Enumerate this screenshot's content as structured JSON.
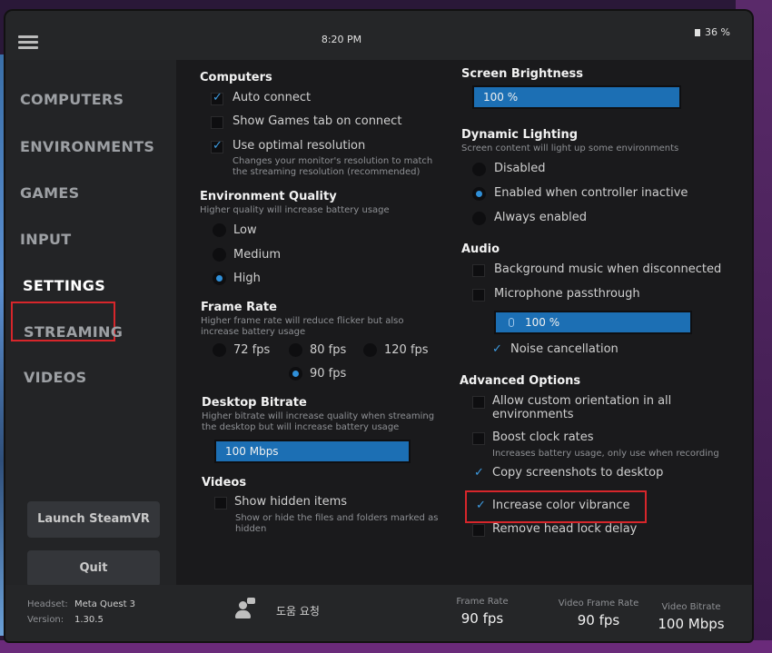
{
  "topbar": {
    "time": "8:20 PM",
    "battery": "36 %"
  },
  "sidebar": {
    "items": [
      "COMPUTERS",
      "ENVIRONMENTS",
      "GAMES",
      "INPUT",
      "SETTINGS",
      "STREAMING",
      "VIDEOS"
    ],
    "active": "SETTINGS",
    "launch_label": "Launch SteamVR",
    "quit_label": "Quit"
  },
  "computers": {
    "title": "Computers",
    "auto_connect": "Auto connect",
    "show_games_tab": "Show Games tab on connect",
    "optimal_resolution": "Use optimal resolution",
    "optimal_desc_1": "Changes your monitor's resolution to match",
    "optimal_desc_2": "the streaming resolution (recommended)"
  },
  "env_quality": {
    "title": "Environment Quality",
    "subtitle": "Higher quality will increase battery usage",
    "low": "Low",
    "medium": "Medium",
    "high": "High",
    "selected": "High"
  },
  "frame_rate": {
    "title": "Frame Rate",
    "subtitle_1": "Higher frame rate will reduce flicker but also",
    "subtitle_2": "increase battery usage",
    "options": [
      "72 fps",
      "80 fps",
      "120 fps",
      "90 fps"
    ],
    "selected": "90 fps"
  },
  "desktop_bitrate": {
    "title": "Desktop Bitrate",
    "subtitle_1": "Higher bitrate will increase quality when streaming",
    "subtitle_2": "the desktop but will increase battery usage",
    "value": "100 Mbps"
  },
  "videos": {
    "title": "Videos",
    "show_hidden": "Show hidden items",
    "desc_1": "Show or hide the files and folders marked as",
    "desc_2": "hidden"
  },
  "brightness": {
    "title": "Screen Brightness",
    "value": "100 %",
    "level": 1.0
  },
  "dynamic_lighting": {
    "title": "Dynamic Lighting",
    "subtitle": "Screen content will light up some environments",
    "disabled": "Disabled",
    "enabled_inactive": "Enabled when controller inactive",
    "always": "Always enabled",
    "selected": "Enabled when controller inactive"
  },
  "audio": {
    "title": "Audio",
    "bg_music": "Background music when disconnected",
    "mic_passthrough": "Microphone passthrough",
    "mic_level": "100 %",
    "noise_cancel": "Noise cancellation"
  },
  "advanced": {
    "title": "Advanced Options",
    "custom_orientation_1": "Allow custom orientation in all",
    "custom_orientation_2": "environments",
    "boost_clock": "Boost clock rates",
    "boost_desc": "Increases battery usage, only use when recording",
    "copy_screenshots": "Copy screenshots to desktop",
    "color_vibrance": "Increase color vibrance",
    "head_lock": "Remove head lock delay"
  },
  "footer": {
    "headset_label": "Headset:",
    "headset_value": "Meta Quest 3",
    "version_label": "Version:",
    "version_value": "1.30.5",
    "help_label": "도움 요청",
    "frame_rate_label": "Frame Rate",
    "frame_rate_value": "90 fps",
    "video_frame_rate_label": "Video Frame Rate",
    "video_frame_rate_value": "90 fps",
    "video_bitrate_label": "Video Bitrate",
    "video_bitrate_value": "100 Mbps"
  },
  "colors": {
    "accent": "#1c6fb4",
    "highlight": "#d7262b",
    "panel": "#1c1c1e"
  }
}
